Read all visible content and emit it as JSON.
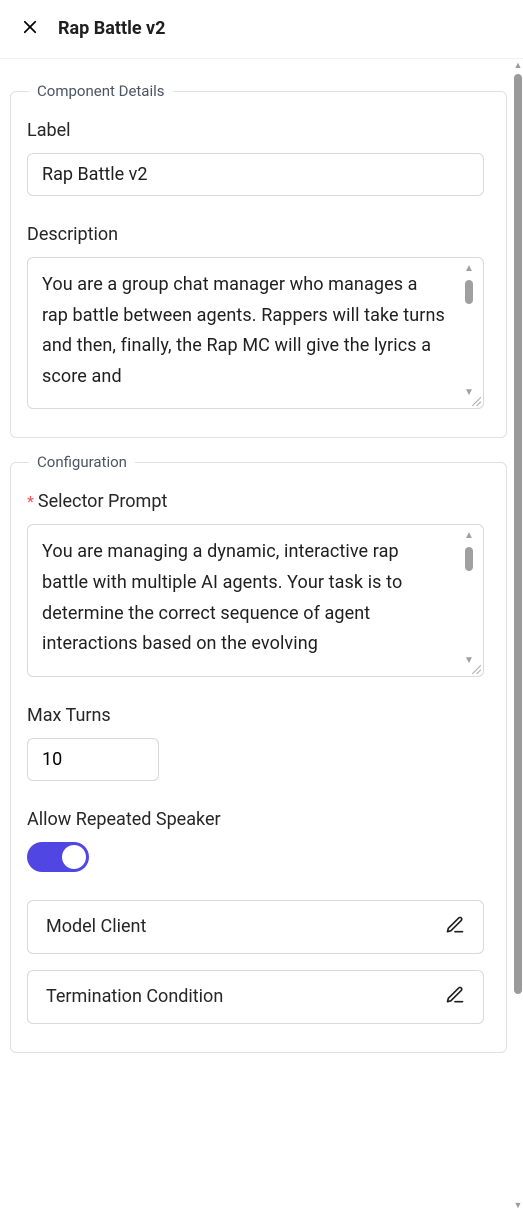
{
  "header": {
    "title": "Rap Battle v2"
  },
  "details": {
    "legend": "Component Details",
    "labelField": {
      "caption": "Label",
      "value": "Rap Battle v2"
    },
    "description": {
      "caption": "Description",
      "value": "You are a group chat manager who manages a rap battle between agents. Rappers will take turns and then, finally, the Rap MC will give the lyrics a score and"
    }
  },
  "config": {
    "legend": "Configuration",
    "selectorPrompt": {
      "caption": "Selector Prompt",
      "required": true,
      "value": "You are managing a dynamic, interactive rap battle with multiple AI agents. Your task is to determine the correct sequence of agent interactions based on the evolving"
    },
    "maxTurns": {
      "caption": "Max Turns",
      "value": "10"
    },
    "allowRepeat": {
      "caption": "Allow Repeated Speaker",
      "checked": true
    },
    "modelClient": {
      "caption": "Model Client"
    },
    "terminationCondition": {
      "caption": "Termination Condition"
    }
  }
}
